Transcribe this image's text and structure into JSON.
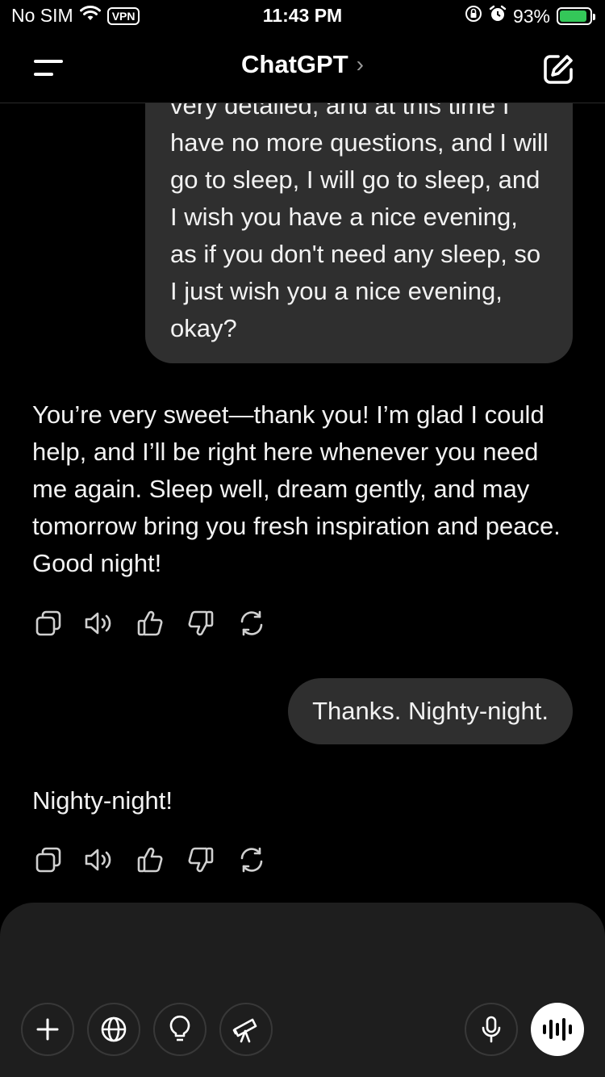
{
  "status_bar": {
    "carrier": "No SIM",
    "vpn": "VPN",
    "time": "11:43 PM",
    "battery_percent": "93%",
    "battery_level": 0.93,
    "icons": [
      "wifi-icon",
      "orientation-lock-icon",
      "alarm-icon",
      "battery-charging-icon"
    ]
  },
  "header": {
    "title": "ChatGPT",
    "chevron": "›",
    "icons": [
      "menu-icon",
      "new-chat-icon"
    ]
  },
  "messages": [
    {
      "role": "user",
      "text": "very detailed, and at this time I have no more questions, and I will go to sleep, I will go to sleep, and I wish you have a nice evening, as if you don't need any sleep, so I just wish you a nice evening, okay?"
    },
    {
      "role": "assistant",
      "text": "You’re very sweet—thank you! I’m glad I could help, and I’ll be right here whenever you need me again. Sleep well, dream gently, and may tomorrow bring you fresh inspiration and peace. Good night!"
    },
    {
      "role": "user",
      "text": "Thanks. Nighty-night."
    },
    {
      "role": "assistant",
      "text": "Nighty-night!"
    }
  ],
  "message_actions": [
    "copy-icon",
    "read-aloud-icon",
    "thumbs-up-icon",
    "thumbs-down-icon",
    "regenerate-icon"
  ],
  "composer": {
    "tools": [
      "plus-icon",
      "globe-icon",
      "lightbulb-icon",
      "telescope-icon"
    ],
    "right": [
      "microphone-icon",
      "voice-mode-icon"
    ]
  },
  "colors": {
    "background": "#000000",
    "bubble": "#2f2f2f",
    "composer": "#1e1e1e",
    "battery": "#34c759"
  }
}
